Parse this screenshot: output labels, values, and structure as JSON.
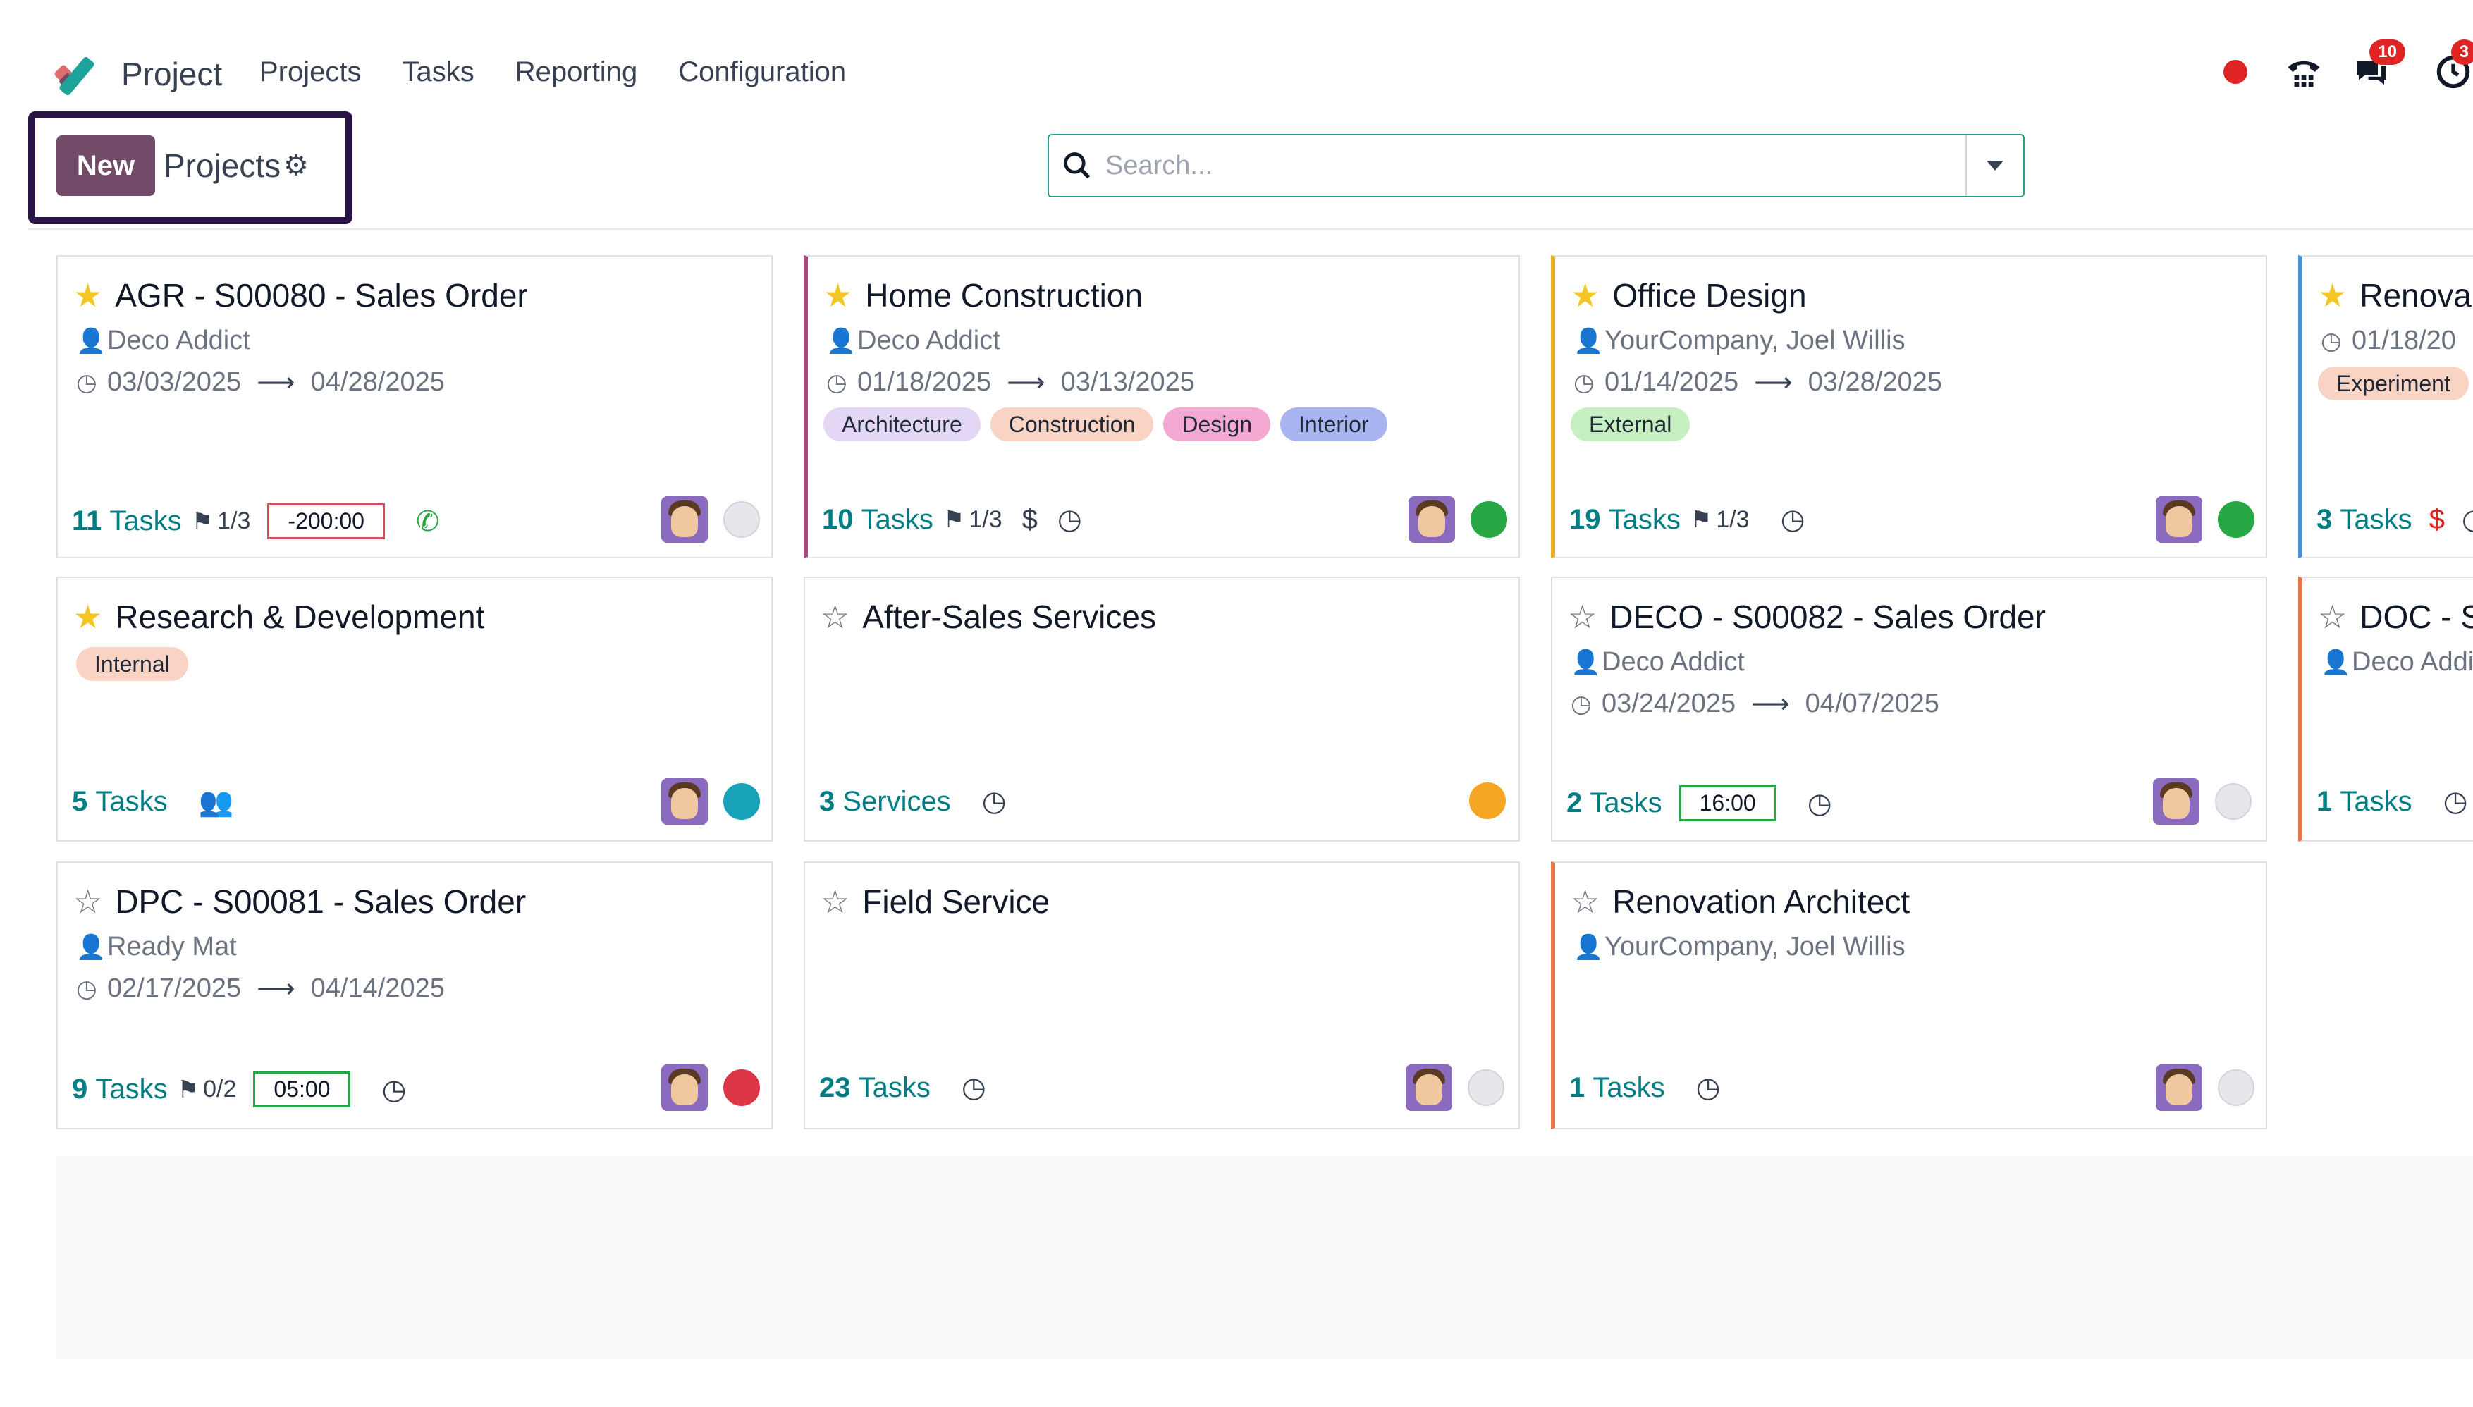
{
  "app": {
    "name": "Project"
  },
  "menu": [
    "Projects",
    "Tasks",
    "Reporting",
    "Configuration"
  ],
  "systray": {
    "messages_badge": "10",
    "activity_badge": "3"
  },
  "control": {
    "new_label": "New",
    "breadcrumb": "Projects",
    "search_placeholder": "Search..."
  },
  "colors": {
    "brand": "#714b67",
    "teal": "#017e84",
    "red": "#e02424",
    "green": "#28a745",
    "orange": "#f5a623",
    "cyan": "#17a2b8",
    "grey": "#e5e7eb"
  },
  "cards": [
    {
      "title": "AGR - S00080 - Sales Order",
      "favorite": true,
      "customer": "Deco Addict",
      "date_start": "03/03/2025",
      "date_end": "04/28/2025",
      "tags": [],
      "tasks_n": "11",
      "tasks_label": "Tasks",
      "milestones": "1/3",
      "time": "-200:00",
      "status": "none",
      "bar": ""
    },
    {
      "title": "Home Construction",
      "favorite": true,
      "customer": "Deco Addict",
      "date_start": "01/18/2025",
      "date_end": "03/13/2025",
      "tags": [
        "Architecture",
        "Construction",
        "Design",
        "Interior"
      ],
      "tasks_n": "10",
      "tasks_label": "Tasks",
      "milestones": "1/3",
      "status": "green",
      "bar": "#a3497c"
    },
    {
      "title": "Office Design",
      "favorite": true,
      "customer": "YourCompany, Joel Willis",
      "date_start": "01/14/2025",
      "date_end": "03/28/2025",
      "tags": [
        "External"
      ],
      "tasks_n": "19",
      "tasks_label": "Tasks",
      "milestones": "1/3",
      "status": "green",
      "bar": "#e6b325"
    },
    {
      "title": "Renova",
      "favorite": true,
      "date_start": "01/18/20",
      "tags": [
        "Experiment"
      ],
      "tasks_n": "3",
      "tasks_label": "Tasks",
      "bar": "#4a90d9"
    },
    {
      "title": "Research & Development",
      "favorite": true,
      "tags": [
        "Internal"
      ],
      "tasks_n": "5",
      "tasks_label": "Tasks",
      "status": "cyan",
      "bar": ""
    },
    {
      "title": "After-Sales Services",
      "favorite": false,
      "tasks_n": "3",
      "tasks_label": "Services",
      "status": "orange",
      "bar": ""
    },
    {
      "title": "DECO - S00082 - Sales Order",
      "favorite": false,
      "customer": "Deco Addict",
      "date_start": "03/24/2025",
      "date_end": "04/07/2025",
      "tasks_n": "2",
      "tasks_label": "Tasks",
      "time": "16:00",
      "status": "none",
      "bar": ""
    },
    {
      "title": "DOC - S",
      "favorite": false,
      "customer": "Deco Addi",
      "tasks_n": "1",
      "tasks_label": "Tasks",
      "bar": "#e8734a"
    },
    {
      "title": "DPC - S00081 - Sales Order",
      "favorite": false,
      "customer": "Ready Mat",
      "date_start": "02/17/2025",
      "date_end": "04/14/2025",
      "tasks_n": "9",
      "tasks_label": "Tasks",
      "milestones": "0/2",
      "time": "05:00",
      "status": "red",
      "bar": ""
    },
    {
      "title": "Field Service",
      "favorite": false,
      "tasks_n": "23",
      "tasks_label": "Tasks",
      "status": "none",
      "bar": ""
    },
    {
      "title": "Renovation Architect",
      "favorite": false,
      "customer": "YourCompany, Joel Willis",
      "tasks_n": "1",
      "tasks_label": "Tasks",
      "status": "none",
      "bar": "#e8734a"
    }
  ]
}
